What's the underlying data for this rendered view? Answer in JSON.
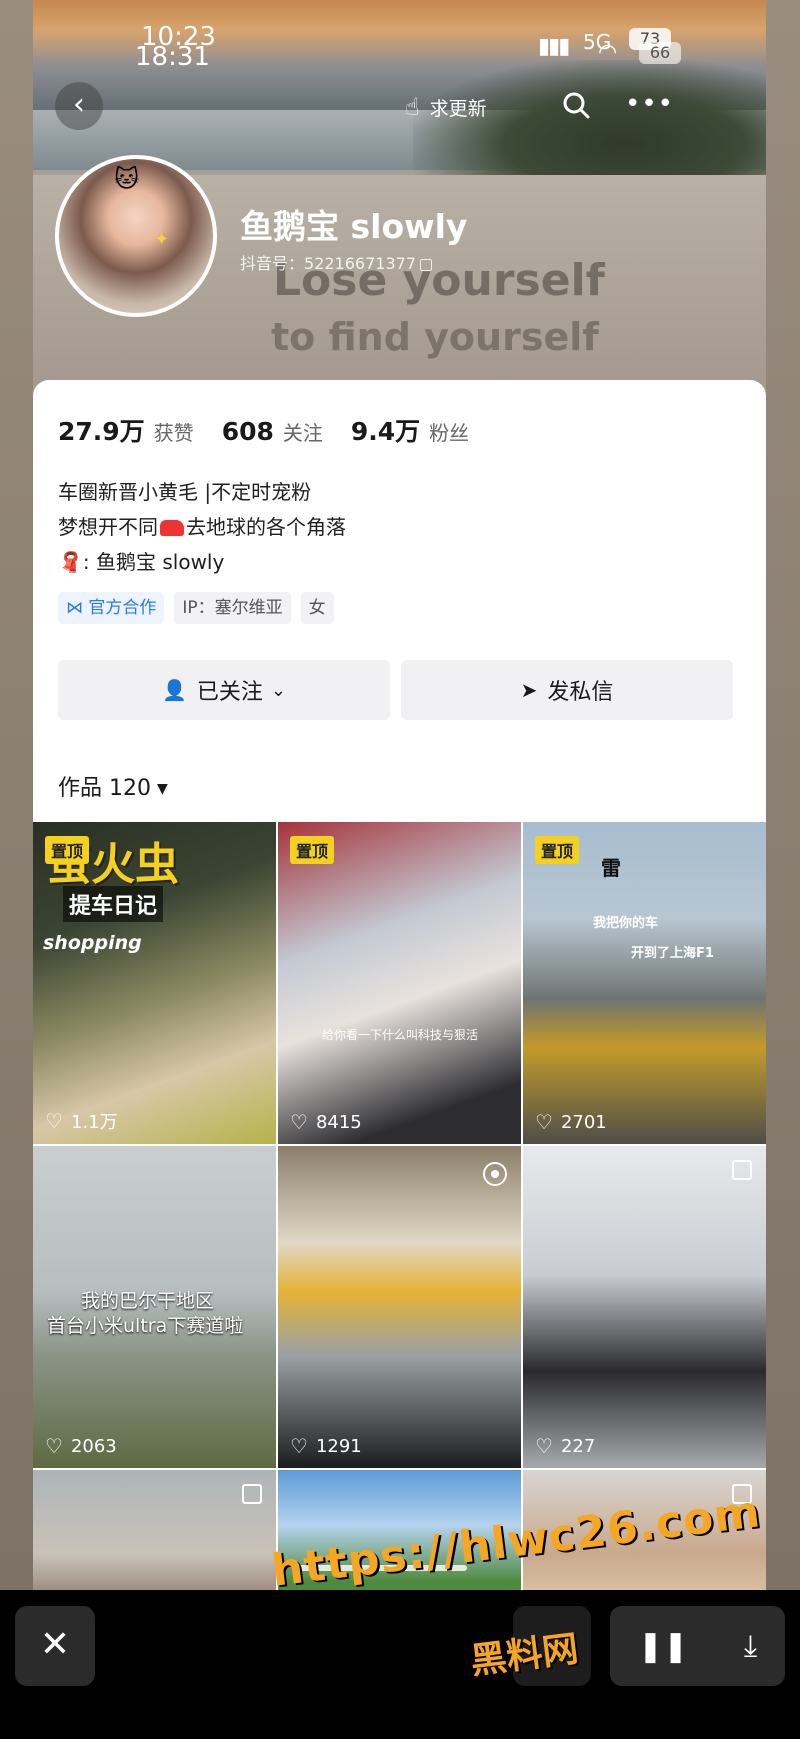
{
  "status": {
    "time_a": "10:23",
    "time_b": "18:31",
    "network": "5G",
    "battery_a": "73",
    "battery_b": "66"
  },
  "nav": {
    "update_label": "求更新"
  },
  "cover": {
    "wall_line1": "Lose yourself",
    "wall_line2": "to find yourself"
  },
  "profile": {
    "name": "鱼鹅宝 slowly",
    "id_label": "抖音号：",
    "id_value": "52216671377"
  },
  "stats": [
    {
      "num": "27.9万",
      "label": "获赞"
    },
    {
      "num": "608",
      "label": "关注"
    },
    {
      "num": "9.4万",
      "label": "粉丝"
    }
  ],
  "bio": {
    "line1": "车圈新晋小黄毛 |不定时宠粉",
    "line2a": "梦想开不同",
    "line2b": "去地球的各个角落",
    "line3a": "🧣",
    "line3b": ": 鱼鹅宝 slowly"
  },
  "tags": [
    {
      "label": "官方合作"
    },
    {
      "label": "IP：塞尔维亚"
    },
    {
      "label": "女"
    }
  ],
  "actions": {
    "follow_label": "已关注",
    "message_label": "发私信"
  },
  "works": {
    "label": "作品 120"
  },
  "tiles": [
    {
      "pin": "置顶",
      "likes": "1.1万",
      "title": "萤火虫",
      "sub": "提车日记",
      "extra": "shopping"
    },
    {
      "pin": "置顶",
      "likes": "8415",
      "caption": "给你看一下什么叫科技与狠活"
    },
    {
      "pin": "置顶",
      "likes": "2701",
      "a": "雷",
      "b": "我把你的车",
      "c": "开到了上海F1"
    },
    {
      "likes": "2063",
      "a": "我的巴尔干地区",
      "b": "首台小米ultra下赛道啦"
    },
    {
      "likes": "1291"
    },
    {
      "likes": "227"
    }
  ],
  "watermark": {
    "url": "https://hlwc26.com",
    "name": "黑料网"
  },
  "colors": {
    "accent_yellow": "#f5d11f",
    "watermark_orange": "#f5a623",
    "tag_blue": "#2c7be5"
  }
}
